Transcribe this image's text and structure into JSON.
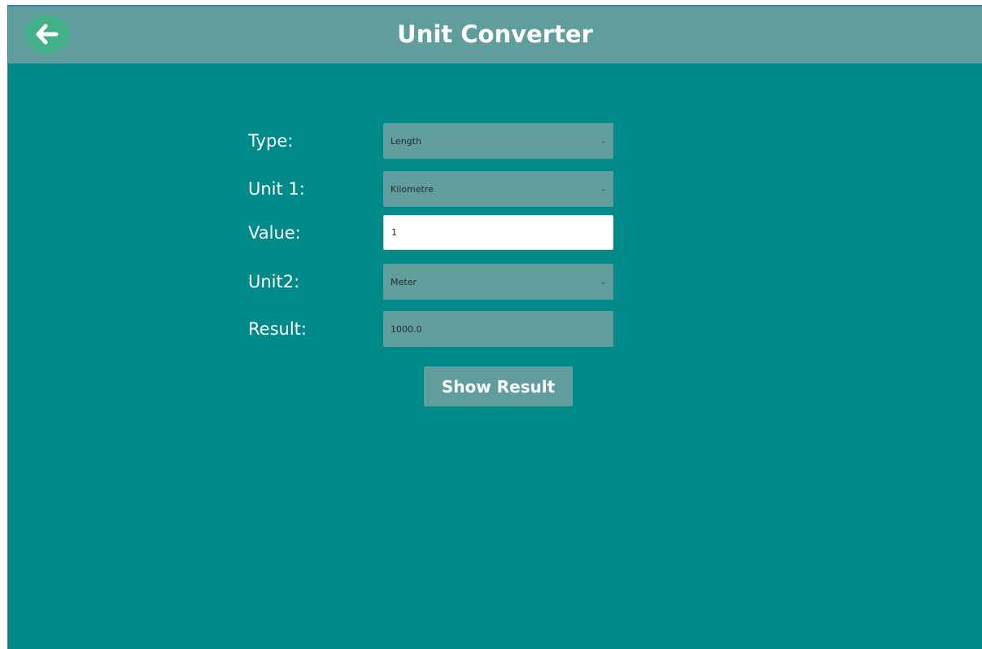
{
  "header": {
    "title": "Unit Converter",
    "back_icon": "arrow-left-icon"
  },
  "form": {
    "type_label": "Type:",
    "type_value": "Length",
    "unit1_label": "Unit 1:",
    "unit1_value": "Kilometre",
    "value_label": "Value:",
    "value_input": "1",
    "unit2_label": "Unit2:",
    "unit2_value": "Meter",
    "result_label": "Result:",
    "result_value": "1000.0",
    "show_button": "Show Result"
  },
  "colors": {
    "background": "#008b8a",
    "header": "#5f9e9d",
    "back_button": "#43b08a",
    "field": "#5f9e9d",
    "text": "#ffffff"
  }
}
